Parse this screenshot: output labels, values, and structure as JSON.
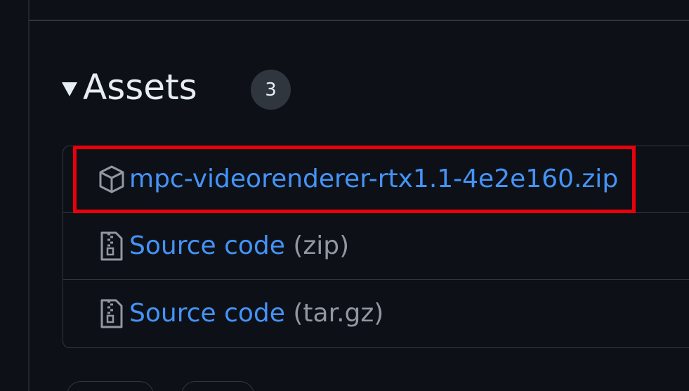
{
  "assets": {
    "title": "Assets",
    "count": "3",
    "items": [
      {
        "icon": "package-icon",
        "name": "mpc-videorenderer-rtx1.1-4e2e160.zip",
        "suffix": ""
      },
      {
        "icon": "file-zip-icon",
        "name": "Source code",
        "suffix": " (zip)"
      },
      {
        "icon": "file-zip-icon",
        "name": "Source code",
        "suffix": " (tar.gz)"
      }
    ]
  },
  "colors": {
    "background": "#0d1117",
    "link": "#4493f8",
    "muted": "#9198a1",
    "highlight": "#e8000b"
  }
}
